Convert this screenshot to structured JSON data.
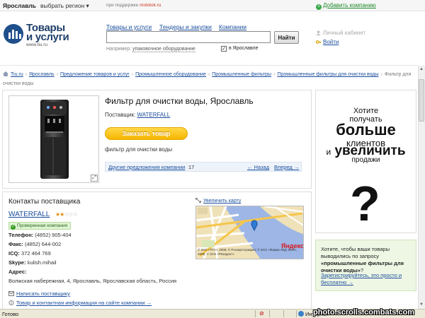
{
  "topbar": {
    "city": "Ярославль",
    "region_link": "выбрать регион ▾",
    "support_prefix": "при поддержке",
    "support_site": "molotok.ru",
    "add_company": "Добавить компанию"
  },
  "logo": {
    "line1": "Товары",
    "line2": "и услуги",
    "url": "www.tiu.ru"
  },
  "nav": {
    "items": [
      "Товары и услуги",
      "Тендеры и закупки",
      "Компании"
    ]
  },
  "search": {
    "value": "",
    "button": "Найти",
    "example_prefix": "Например:",
    "example_value": "упаковочное оборудование",
    "region_checkbox": "в Ярославле",
    "region_checked": true
  },
  "account": {
    "cabinet": "Личный кабинет",
    "login": "Войти"
  },
  "breadcrumb": {
    "items": [
      "Tiu.ru",
      "Ярославль",
      "Предложение товаров и услуг",
      "Промышленное оборудование",
      "Промышленные фильтры",
      "Промышленные фильтры для очистки воды"
    ],
    "current": "Фильтр для очистки воды"
  },
  "product": {
    "title": "Фильтр для очистки воды, Ярославль",
    "supplier_label": "Поставщик:",
    "supplier_name": "WATERFALL",
    "order_button": "Заказать товар",
    "description": "фильтр для очистки воды",
    "other_offers": "Другие предложения компании",
    "other_count": "17",
    "prev": "← Назад",
    "next": "Вперед →"
  },
  "contacts": {
    "title": "Контакты поставщика",
    "company": "WATERFALL",
    "rating_stars": 2,
    "rating_max": 5,
    "verified_badge": "Проверенная компания",
    "phone_label": "Телефон:",
    "phone": "(4852) 905-404",
    "fax_label": "Факс:",
    "fax": "(4852) 644-002",
    "icq_label": "ICQ:",
    "icq": "372 464 769",
    "skype_label": "Skype:",
    "skype": "kulish.mihail",
    "address_label": "Адрес:",
    "address": "Волжская набережная, 4, Ярославль, Ярославская область, Россия",
    "write_link": "Написать поставщику",
    "more_link": "Товар и контактная информация на сайте компании →",
    "map_zoom": "Увеличить карту",
    "map_brand": "Яндекс",
    "map_copyright": "© ЗАО «ТГА», 2008; © Роскартография; © ЗАО «Фирма ЛКД ЭНИ», 2008; © ЗАО «Резидент»"
  },
  "ad": {
    "l1": "Хотите",
    "l2": "получать",
    "l3": "больше",
    "l4": "клиентов",
    "l5a": "и",
    "l5b": "увеличить",
    "l6": "продажи",
    "q": "?"
  },
  "promo": {
    "text_prefix": "Хотите, чтобы ваши товары выводились по запросу",
    "query": "«промышленные фильтры для очистки воды»",
    "text_suffix": "?",
    "link": "Зарегистрируйтесь, это просто и бесплатно →"
  },
  "statusbar": {
    "ready": "Готово",
    "zone": "Интернет",
    "watermark": "photo.scrolls.combats.com"
  },
  "colors": {
    "link": "#1a4d9c",
    "order_button": "#f7b500",
    "logo": "#1e4f8a",
    "verified": "#3a9c24"
  }
}
